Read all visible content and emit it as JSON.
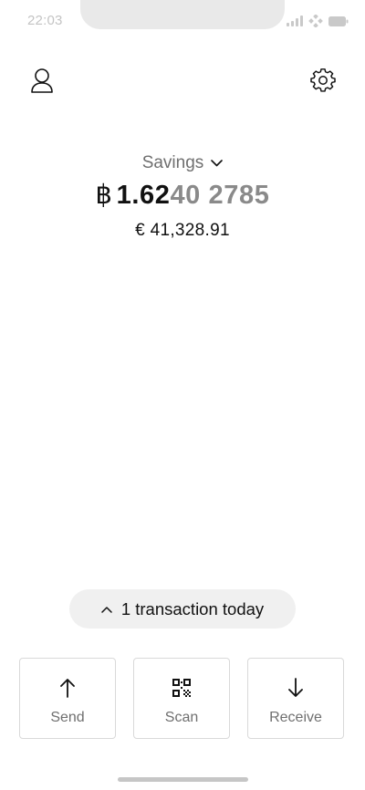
{
  "status_bar": {
    "time": "22:03"
  },
  "header": {
    "profile_icon": "user-icon",
    "settings_icon": "gear-icon"
  },
  "wallet": {
    "name": "Savings",
    "currency_symbol": "฿",
    "balance_strong": "1.62",
    "balance_faint": "40 2785",
    "fiat_balance": "€ 41,328.91"
  },
  "transactions": {
    "label": "1 transaction today"
  },
  "actions": {
    "send_label": "Send",
    "scan_label": "Scan",
    "receive_label": "Receive"
  },
  "colors": {
    "muted_text": "#6f6f6f",
    "faint_digits": "#8a8a8a",
    "pill_background": "#f0f0f0",
    "button_border": "#d9d9d9"
  }
}
